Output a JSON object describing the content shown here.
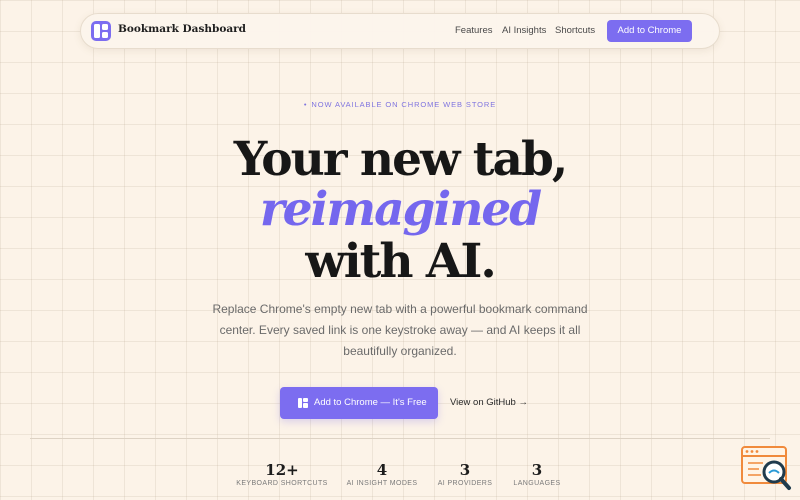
{
  "navbar": {
    "brand": "Bookmark Dashboard",
    "links": [
      "Features",
      "AI Insights",
      "Shortcuts"
    ],
    "cta": "Add to Chrome"
  },
  "hero": {
    "eyebrow_dot": "•",
    "eyebrow": "NOW AVAILABLE ON CHROME WEB STORE",
    "line1": "Your new tab,",
    "line2": "reimagined",
    "line3": "with AI.",
    "subtitle": "Replace Chrome's empty new tab with a powerful bookmark command center. Every saved link is one keystroke away — and AI keeps it all beautifully organized.",
    "primary_button": "Add to Chrome — It's Free",
    "secondary_button": "View on GitHub →"
  },
  "stats": [
    {
      "value": "12+",
      "label": "KEYBOARD SHORTCUTS"
    },
    {
      "value": "4",
      "label": "AI INSIGHT MODES"
    },
    {
      "value": "3",
      "label": "AI PROVIDERS"
    },
    {
      "value": "3",
      "label": "LANGUAGES"
    }
  ],
  "colors": {
    "background": "#fcf3e8",
    "accent": "#7c6df0",
    "heading": "#171717",
    "body_text": "#6a6a6a"
  },
  "icons": {
    "brand": "dashboard-grid-icon",
    "primary_button": "extension-grid-icon",
    "corner_badge": "browser-search-icon"
  }
}
